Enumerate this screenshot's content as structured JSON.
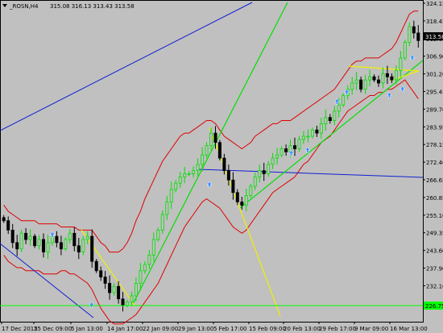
{
  "header": {
    "symbol": "_ROSN,H4",
    "ohlc": "315.08 316.13 313.43 313.58"
  },
  "colors": {
    "background": "#c0c0c0",
    "bull_candle": "#00e000",
    "bear_candle": "#000000",
    "bollinger": "#e00000",
    "trend_green": "#00e000",
    "trend_yellow": "#f0f000",
    "trend_blue": "#1020d0",
    "support_line": "#00ff00",
    "arrow": "#4090ff"
  },
  "price_labels": {
    "current": "313.58",
    "support": "226.75"
  },
  "chart_data": {
    "type": "candlestick",
    "ylim": [
      224.5,
      325.5
    ],
    "y_ticks": [
      "324.15",
      "318.45",
      "312.65",
      "306.90",
      "301.20",
      "295.45",
      "289.70",
      "283.95",
      "278.15",
      "272.40",
      "266.65",
      "260.85",
      "255.10",
      "249.35",
      "243.60",
      "237.90",
      "232.10",
      "226.35"
    ],
    "x_ticks": [
      "17 Dec 2015",
      "25 Dec 09:00",
      "5 Jan 13:00",
      "14 Jan 17:00",
      "22 Jan 09:00",
      "29 Jan 13:00",
      "5 Feb 17:00",
      "15 Feb 09:00",
      "20 Feb 13:00",
      "29 Feb 17:00",
      "9 Mar 09:00",
      "16 Mar 13:00"
    ],
    "closes": [
      256,
      253,
      249,
      247,
      252,
      250,
      251,
      248,
      250,
      246,
      249,
      251,
      249,
      247,
      250,
      252,
      248,
      246,
      250,
      251,
      243,
      240,
      238,
      236,
      233,
      235,
      231,
      229,
      230,
      232,
      236,
      240,
      242,
      245,
      250,
      253,
      258,
      262,
      266,
      268,
      270,
      271,
      271,
      272,
      274,
      277,
      280,
      284,
      281,
      276,
      272,
      269,
      265,
      262,
      261,
      264,
      267,
      270,
      272,
      271,
      274,
      276,
      277,
      279,
      278,
      280,
      279,
      282,
      283,
      283,
      285,
      284,
      287,
      289,
      288,
      291,
      293,
      296,
      298,
      300,
      301,
      298,
      301,
      302,
      301,
      300,
      303,
      302,
      301,
      304,
      308,
      313,
      318,
      316,
      313.58
    ],
    "bollinger_upper": [
      261,
      259,
      258,
      257,
      256,
      256,
      256,
      256,
      255,
      255,
      255,
      255,
      255,
      254,
      254,
      254,
      254,
      253,
      253,
      253,
      253,
      251,
      249,
      248,
      246,
      246,
      246,
      247,
      249,
      252,
      256,
      259,
      263,
      266,
      269,
      272,
      275,
      277,
      279,
      281,
      283,
      284,
      284,
      285,
      286,
      287,
      288,
      288,
      287,
      285,
      283,
      282,
      281,
      280,
      279,
      280,
      281,
      283,
      284,
      285,
      286,
      287,
      287,
      288,
      288,
      288,
      289,
      290,
      291,
      292,
      293,
      294,
      295,
      296,
      297,
      298,
      300,
      302,
      304,
      306,
      307,
      307,
      308,
      308,
      308,
      308,
      309,
      310,
      311,
      313,
      316,
      319,
      322,
      323,
      323
    ],
    "bollinger_lower": [
      245,
      243,
      242,
      241,
      241,
      240,
      240,
      240,
      240,
      239,
      239,
      239,
      239,
      240,
      240,
      239,
      239,
      238,
      237,
      236,
      234,
      231,
      228,
      226,
      224,
      223,
      223,
      223,
      224,
      225,
      226,
      228,
      230,
      232,
      234,
      236,
      239,
      242,
      245,
      248,
      251,
      254,
      256,
      258,
      260,
      262,
      263,
      262,
      261,
      260,
      258,
      256,
      254,
      253,
      252,
      253,
      255,
      257,
      259,
      261,
      263,
      265,
      266,
      267,
      268,
      269,
      270,
      272,
      274,
      275,
      277,
      279,
      281,
      282,
      283,
      285,
      287,
      289,
      291,
      292,
      293,
      294,
      295,
      296,
      296,
      297,
      297,
      298,
      298,
      299,
      300,
      301,
      299,
      297,
      295
    ],
    "arrows_up": [
      {
        "i": 15,
        "price": 251.5
      },
      {
        "i": 27,
        "price": 229
      },
      {
        "i": 63,
        "price": 267.5
      },
      {
        "i": 88,
        "price": 277.5
      },
      {
        "i": 93,
        "price": 278.5
      },
      {
        "i": 102,
        "price": 294
      },
      {
        "i": 105,
        "price": 297
      },
      {
        "i": 118,
        "price": 296
      },
      {
        "i": 122,
        "price": 298
      },
      {
        "i": 125,
        "price": 308
      }
    ]
  }
}
